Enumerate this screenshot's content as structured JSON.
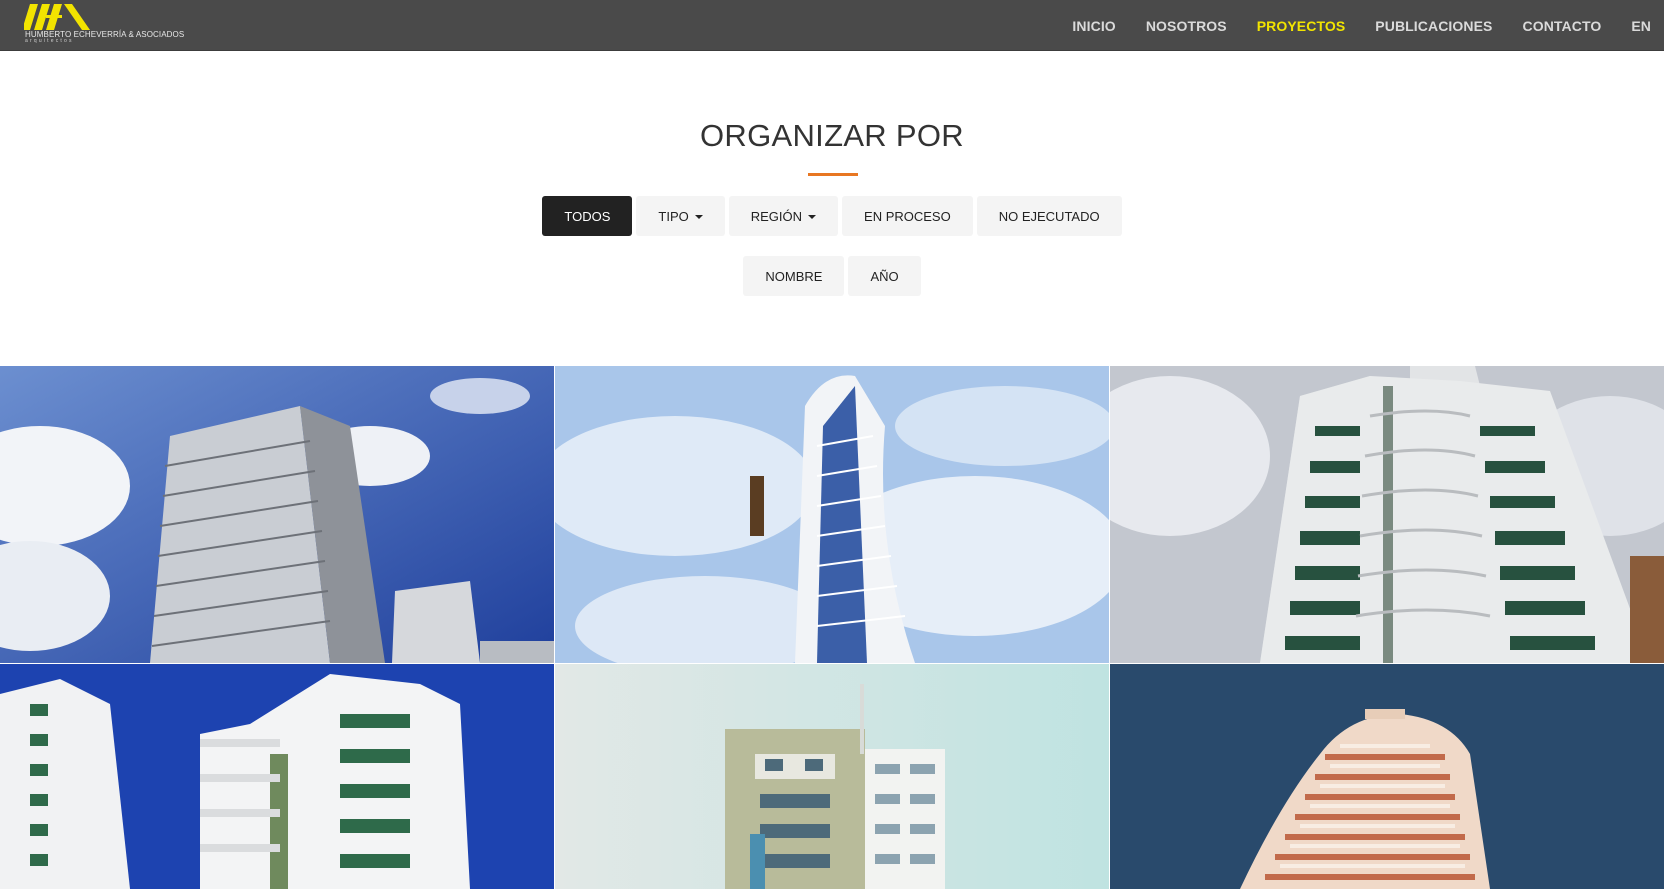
{
  "brand": {
    "name": "HUMBERTO ECHEVERRÍA & ASOCIADOS",
    "sub": "arquitectos",
    "accent_color": "#f2e400"
  },
  "nav": {
    "items": [
      {
        "label": "INICIO",
        "active": false
      },
      {
        "label": "NOSOTROS",
        "active": false
      },
      {
        "label": "PROYECTOS",
        "active": true
      },
      {
        "label": "PUBLICACIONES",
        "active": false
      },
      {
        "label": "CONTACTO",
        "active": false
      },
      {
        "label": "EN",
        "active": false
      }
    ]
  },
  "section": {
    "title": "ORGANIZAR POR",
    "underline_color": "#e87722"
  },
  "filters": {
    "todos": "TODOS",
    "tipo": "TIPO",
    "region": "REGIÓN",
    "en_proceso": "EN PROCESO",
    "no_ejecutado": "NO EJECUTADO",
    "nombre": "NOMBRE",
    "anio": "AÑO"
  },
  "projects": [
    {
      "icon": "tower-photo-1"
    },
    {
      "icon": "tower-photo-2"
    },
    {
      "icon": "tower-photo-3"
    },
    {
      "icon": "tower-photo-4"
    },
    {
      "icon": "tower-photo-5"
    },
    {
      "icon": "tower-photo-6"
    }
  ]
}
